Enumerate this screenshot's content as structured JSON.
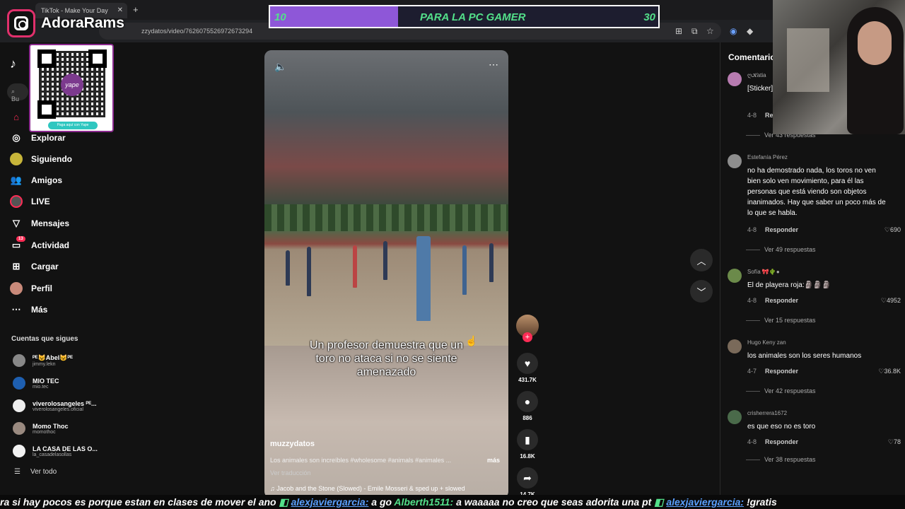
{
  "browser": {
    "tab_title": "TikTok - Make Your Day",
    "url": "zzydatos/video/7626075526972673294"
  },
  "overlay": {
    "streamer_name": "AdoraRams",
    "qr_caption": "Paga aquí con Yape",
    "qr_logo_text": "yape",
    "goal_left": "10",
    "goal_title": "PARA LA PC GAMER",
    "goal_right": "30",
    "goal_progress": 0.33
  },
  "sidebar": {
    "search_placeholder": "Bu",
    "nav": [
      {
        "label": "Explorar",
        "icon": "compass-icon"
      },
      {
        "label": "Siguiendo",
        "icon": "following-icon"
      },
      {
        "label": "Amigos",
        "icon": "friends-icon"
      },
      {
        "label": "LIVE",
        "icon": "live-icon"
      },
      {
        "label": "Mensajes",
        "icon": "messages-icon"
      },
      {
        "label": "Actividad",
        "icon": "activity-icon",
        "badge": "13"
      },
      {
        "label": "Cargar",
        "icon": "upload-icon"
      },
      {
        "label": "Perfil",
        "icon": "profile-icon"
      },
      {
        "label": "Más",
        "icon": "more-icon"
      }
    ],
    "following_title": "Cuentas que sigues",
    "following": [
      {
        "name": "ᴾᴱ😺Abel😺ᴾᴱ",
        "handle": "jimmy.lekn"
      },
      {
        "name": "MIO TEC",
        "handle": "mio.tec"
      },
      {
        "name": "viverolosangeles ᴾᴱ...",
        "handle": "viverolosangeles.oficial"
      },
      {
        "name": "Momo Thoc",
        "handle": "momothoc"
      },
      {
        "name": "LA CASA DE LAS O...",
        "handle": "la_casadelasollas"
      }
    ],
    "see_all": "Ver todo"
  },
  "video": {
    "caption": "Un profesor demuestra que un toro no ataca si no se siente amenazado",
    "author": "muzzydatos",
    "description": "Los animales son increíbles #wholesome #animals #animales ...",
    "more": "más",
    "translate": "Ver traducción",
    "music": "♫  Jacob and the Stone (Slowed) - Emile Mosseri & sped up + slowed"
  },
  "actions": {
    "likes": "431.7K",
    "comments": "886",
    "saves": "16.8K",
    "shares": "14.7K"
  },
  "comments": {
    "title": "Comentarios",
    "items": [
      {
        "user": "ღ𝓚atia",
        "text": "[Sticker] video",
        "date": "4-8",
        "reply": "Res",
        "likes": "",
        "replies": "Ver 43 respuestas"
      },
      {
        "user": "Estefanía Pérez",
        "text": "no ha demostrado nada, los toros no ven bien solo ven movimiento, para él las personas que está viendo son objetos inanimados. Hay que saber un poco más de lo que se habla.",
        "date": "4-8",
        "reply": "Responder",
        "likes": "690",
        "replies": "Ver 49 respuestas"
      },
      {
        "user": "Sofía 🎀🌵●",
        "text": "El de playera roja:🗿🗿🗿",
        "date": "4-8",
        "reply": "Responder",
        "likes": "4952",
        "replies": "Ver 15 respuestas"
      },
      {
        "user": "Hugo Keny zan",
        "text": "los animales son los seres humanos",
        "date": "4-7",
        "reply": "Responder",
        "likes": "36.8K",
        "replies": "Ver 42 respuestas"
      },
      {
        "user": "crisherrera1672",
        "text": "es que eso no es toro",
        "date": "4-8",
        "reply": "Responder",
        "likes": "78",
        "replies": "Ver 38 respuestas"
      }
    ]
  },
  "chat": {
    "m1": "ra si hay pocos es porque estan en clases de mover el ano",
    "u2": "alexjaviergarcia:",
    "m2": "a go",
    "u3": "Alberth1511:",
    "m3": "a waaaaa no creo que seas adorita una pt",
    "u4": "alexjaviergarcia:",
    "m4": "!gratis"
  }
}
